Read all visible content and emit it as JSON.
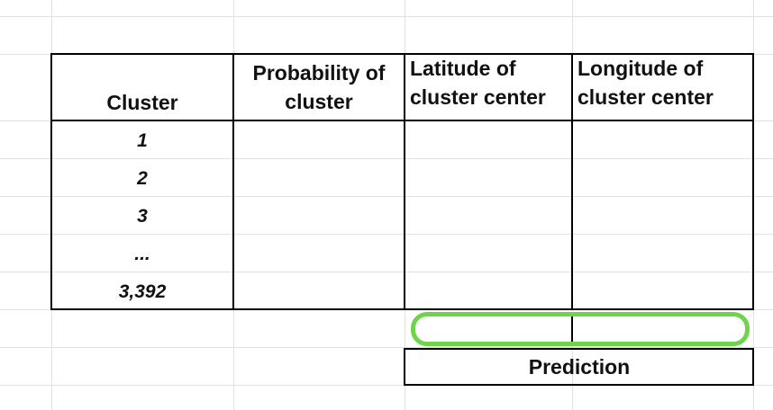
{
  "table": {
    "headers": {
      "cluster": "Cluster",
      "probability_line1": "Probability of",
      "probability_line2": "cluster",
      "latitude_line1": "Latitude of",
      "latitude_line2": "cluster center",
      "longitude_line1": "Longitude of",
      "longitude_line2": "cluster center"
    },
    "rows": [
      "1",
      "2",
      "3",
      "...",
      "3,392"
    ]
  },
  "prediction": {
    "label": "Prediction",
    "highlight_color": "#6ed44a"
  }
}
